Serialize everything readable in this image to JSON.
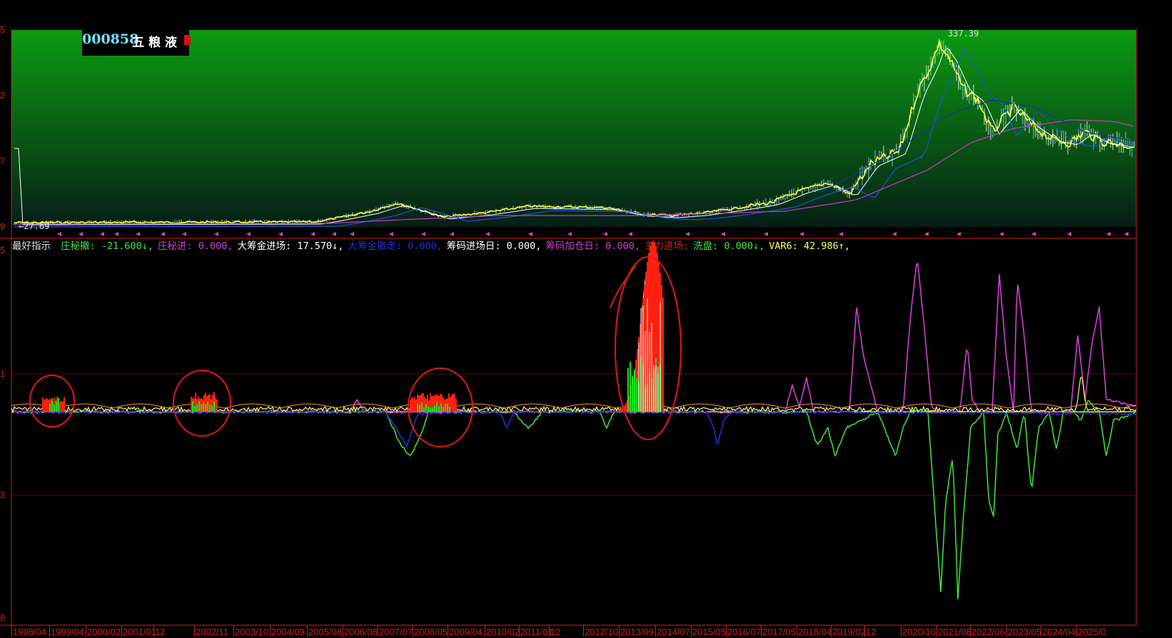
{
  "stock": {
    "code": "000858",
    "name": "五粮液"
  },
  "price_axis": {
    "top_partial": "5",
    "tick1": "2",
    "tick2": "7",
    "bottom_partial": "9"
  },
  "price_markers": {
    "high": "337.39",
    "low": "27.69"
  },
  "indicator_axis": {
    "t1": "5",
    "t2": "1",
    "t3": "3",
    "t4": "8"
  },
  "indicator": {
    "label": "最好指示",
    "items": [
      {
        "name": "庄秘撤",
        "value": "-21.600",
        "arrow": "↓",
        "color": "#3ee83e"
      },
      {
        "name": "庄秘进",
        "value": "0.000",
        "arrow": "",
        "color": "#d040d0"
      },
      {
        "name": "大筹金进场",
        "value": "17.570",
        "arrow": "↓",
        "color": "#ffffff"
      },
      {
        "name": "大筹金撤走",
        "value": "0.000",
        "arrow": "",
        "color": "#2030d0"
      },
      {
        "name": "筹码进场日",
        "value": "0.000",
        "arrow": "",
        "color": "#ffffff"
      },
      {
        "name": "筹码加仓日",
        "value": "0.000",
        "arrow": "",
        "color": "#d040d0"
      },
      {
        "name": "主力进场",
        "value": "",
        "arrow": "",
        "color": "#d02020"
      },
      {
        "name": "洗盘",
        "value": "0.000",
        "arrow": "↓",
        "color": "#3ee83e"
      },
      {
        "name": "VAR6",
        "value": "42.986",
        "arrow": "↑",
        "color": "#ffff60"
      }
    ]
  },
  "x_axis": [
    "1998/04",
    "1999/04",
    "2000/02",
    "2001/01",
    "12",
    "2002/11",
    "2003/10",
    "2004/09",
    "2005/08",
    "2006/08",
    "2007/07",
    "2008/05",
    "2009/04",
    "2010/02",
    "2011/01",
    "12",
    "2012/10",
    "2013/09",
    "2014/07",
    "2015/05",
    "2016/07",
    "2017/05",
    "2018/04",
    "2019/02",
    "12",
    "2020/10",
    "2021/08",
    "2022/06",
    "2023/05",
    "2024/04",
    "2025/0"
  ],
  "colors": {
    "axis_red": "#d02020",
    "up_green": "#3ee83e",
    "down_magenta": "#d040d0",
    "main_red": "#ff2010",
    "blue": "#2030d0",
    "yellow": "#ffff60"
  }
}
